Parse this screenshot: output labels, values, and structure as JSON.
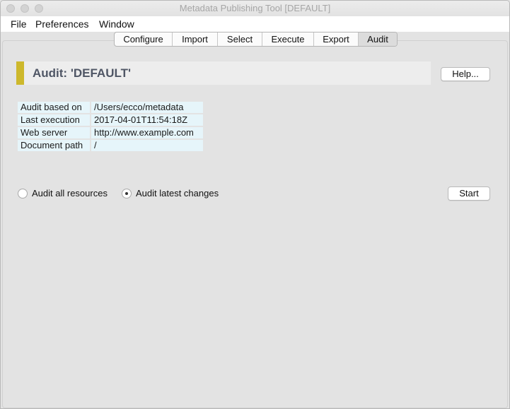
{
  "window": {
    "title": "Metadata Publishing Tool [DEFAULT]"
  },
  "menubar": {
    "items": [
      {
        "label": "File"
      },
      {
        "label": "Preferences"
      },
      {
        "label": "Window"
      }
    ]
  },
  "tabs": {
    "active": "Audit",
    "items": [
      {
        "label": "Configure"
      },
      {
        "label": "Import"
      },
      {
        "label": "Select"
      },
      {
        "label": "Execute"
      },
      {
        "label": "Export"
      },
      {
        "label": "Audit"
      }
    ]
  },
  "header": {
    "title": "Audit: 'DEFAULT'",
    "accent_color": "#cdb82c",
    "help_label": "Help..."
  },
  "info": {
    "rows": [
      {
        "label": "Audit based on",
        "value": "/Users/ecco/metadata"
      },
      {
        "label": "Last execution",
        "value": "2017-04-01T11:54:18Z"
      },
      {
        "label": "Web server",
        "value": "http://www.example.com"
      },
      {
        "label": "Document path",
        "value": "/"
      }
    ]
  },
  "options": {
    "audit_all_label": "Audit all resources",
    "audit_latest_label": "Audit latest changes",
    "selected": "Audit latest changes",
    "start_label": "Start"
  }
}
